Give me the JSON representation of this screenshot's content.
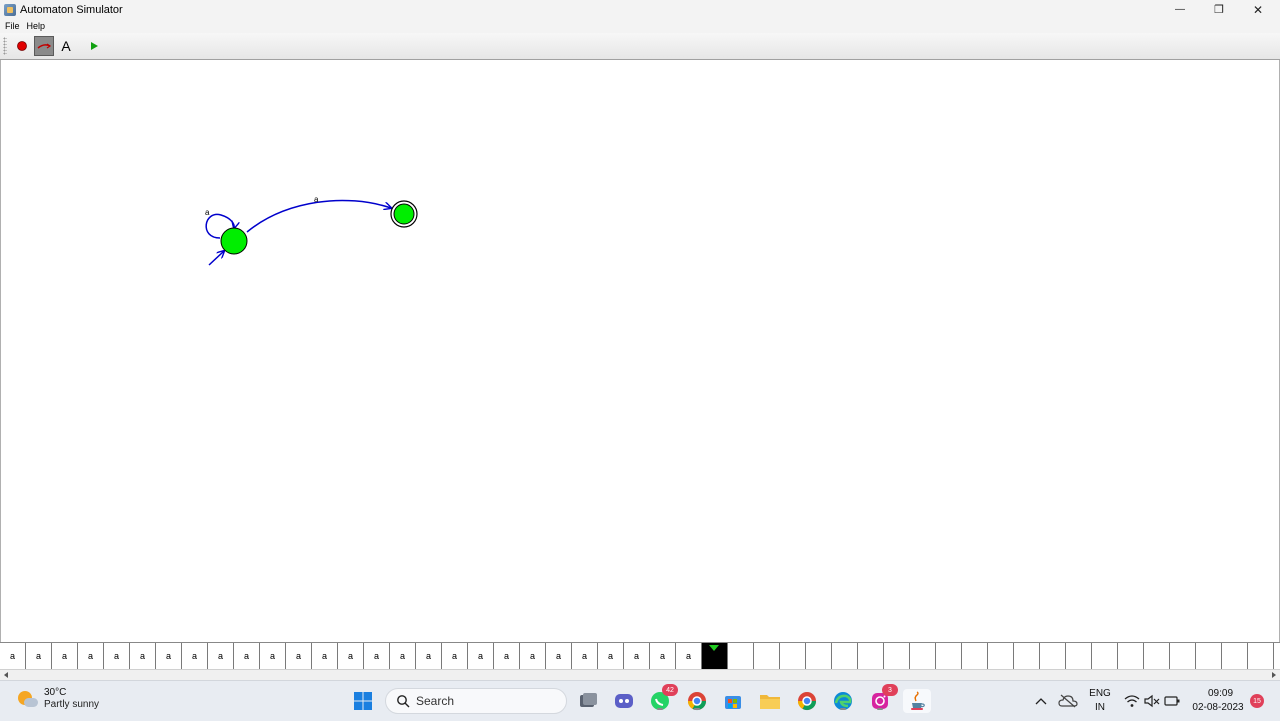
{
  "window": {
    "title": "Automaton Simulator",
    "minimize": "—",
    "restore": "❐",
    "close": "✕"
  },
  "menu": {
    "items": [
      {
        "label": "File"
      },
      {
        "label": "Help"
      }
    ]
  },
  "toolbar": {
    "tools": [
      {
        "name": "add-state-tool",
        "icon": "red-dot-icon"
      },
      {
        "name": "add-transition-tool",
        "icon": "arrow-icon",
        "selected": true
      },
      {
        "name": "text-tool",
        "icon": "letter-a-icon",
        "glyph": "A"
      },
      {
        "name": "run-tool",
        "icon": "play-icon"
      }
    ]
  },
  "automaton": {
    "states": [
      {
        "id": "q0",
        "initial": true,
        "accepting": false,
        "color": "#00ff00"
      },
      {
        "id": "q1",
        "initial": false,
        "accepting": true,
        "color": "#00ff00"
      }
    ],
    "transitions": [
      {
        "from": "q0",
        "to": "q0",
        "label": "a"
      },
      {
        "from": "q0",
        "to": "q1",
        "label": "a"
      }
    ],
    "edge_color": "#0000cc"
  },
  "tape": {
    "symbols": [
      "a",
      "a",
      "a",
      "a",
      "a",
      "a",
      "a",
      "a",
      "a",
      "a",
      "a",
      "a",
      "a",
      "a",
      "a",
      "a",
      "a",
      "a",
      "a",
      "a",
      "a",
      "a",
      "a",
      "a",
      "a",
      "a",
      "a",
      "",
      "",
      "",
      "",
      "",
      "",
      "",
      "",
      "",
      "",
      "",
      "",
      "",
      "",
      "",
      "",
      "",
      "",
      "",
      "",
      "",
      ""
    ],
    "head_index": 27,
    "head_color": "#000000",
    "marker_color": "#22cc22"
  },
  "taskbar": {
    "weather": {
      "temp": "30°C",
      "desc": "Partly sunny"
    },
    "search_placeholder": "Search",
    "apps": [
      {
        "name": "start-button",
        "icon": "windows-icon"
      },
      {
        "name": "task-view-button",
        "icon": "task-view-icon"
      },
      {
        "name": "teams-button",
        "icon": "teams-icon"
      },
      {
        "name": "whatsapp-button",
        "icon": "whatsapp-icon",
        "badge": "42"
      },
      {
        "name": "chrome-profile-button",
        "icon": "chrome-icon"
      },
      {
        "name": "store-button",
        "icon": "store-icon"
      },
      {
        "name": "file-explorer-button",
        "icon": "folder-icon"
      },
      {
        "name": "chrome-button",
        "icon": "chrome-icon"
      },
      {
        "name": "edge-button",
        "icon": "edge-icon"
      },
      {
        "name": "instagram-button",
        "icon": "instagram-icon",
        "badge": "3"
      },
      {
        "name": "java-app-button",
        "icon": "java-icon"
      }
    ],
    "tray": {
      "lang_top": "ENG",
      "lang_bottom": "IN",
      "time": "09:09",
      "date": "02-08-2023",
      "notification_count": "15"
    }
  }
}
